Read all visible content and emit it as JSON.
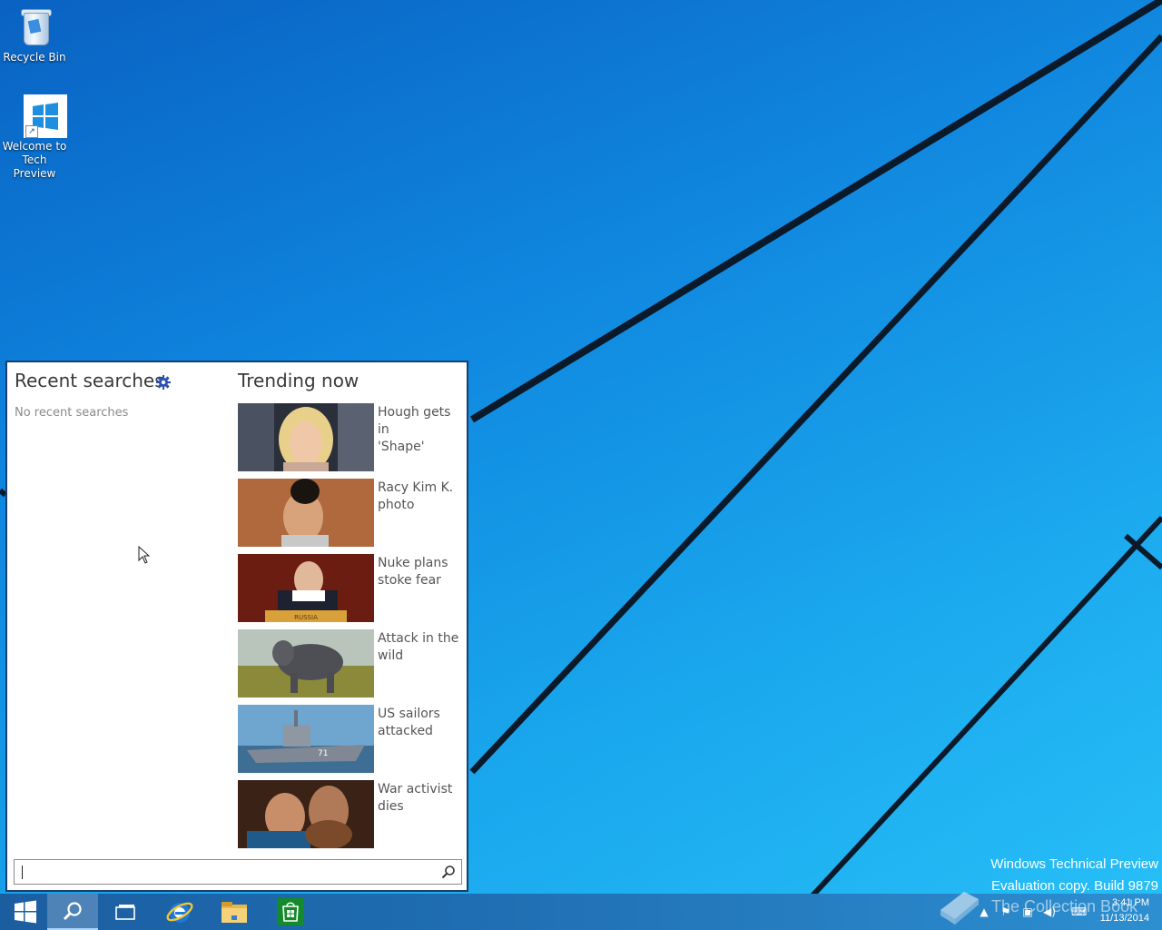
{
  "desktop": {
    "icons": [
      {
        "label": "Recycle Bin",
        "icon": "recycle-bin-icon"
      },
      {
        "label_line1": "Welcome to",
        "label_line2": "Tech Preview",
        "icon": "windows-logo-icon"
      }
    ],
    "accent": "#1aa3ee"
  },
  "search_panel": {
    "recent_title": "Recent searches",
    "recent_empty": "No recent searches",
    "trending_title": "Trending now",
    "trending": [
      {
        "line1": "Hough gets in",
        "line2": "'Shape'",
        "thumb": "portrait-blonde"
      },
      {
        "line1": "Racy Kim K.",
        "line2": "photo",
        "thumb": "portrait-dark-hair"
      },
      {
        "line1": "Nuke plans",
        "line2": "stoke fear",
        "thumb": "speaker-podium"
      },
      {
        "line1": "Attack in the",
        "line2": "wild",
        "thumb": "baby-elephant"
      },
      {
        "line1": "US sailors",
        "line2": "attacked",
        "thumb": "navy-ship"
      },
      {
        "line1": "War activist",
        "line2": "dies",
        "thumb": "couple-portrait"
      }
    ],
    "thumb_text": "RUSSIA",
    "search_input_value": "",
    "search_input_placeholder": ""
  },
  "taskbar": {
    "buttons": [
      "start-icon",
      "search-icon",
      "task-view-icon",
      "internet-explorer-icon",
      "file-explorer-icon",
      "store-icon"
    ],
    "clock_time": "3:41 PM",
    "clock_date": "11/13/2014"
  },
  "watermark": {
    "line1": "Windows Technical Preview",
    "line2": "Evaluation copy. Build 9879",
    "brand": "The Collection Book"
  }
}
